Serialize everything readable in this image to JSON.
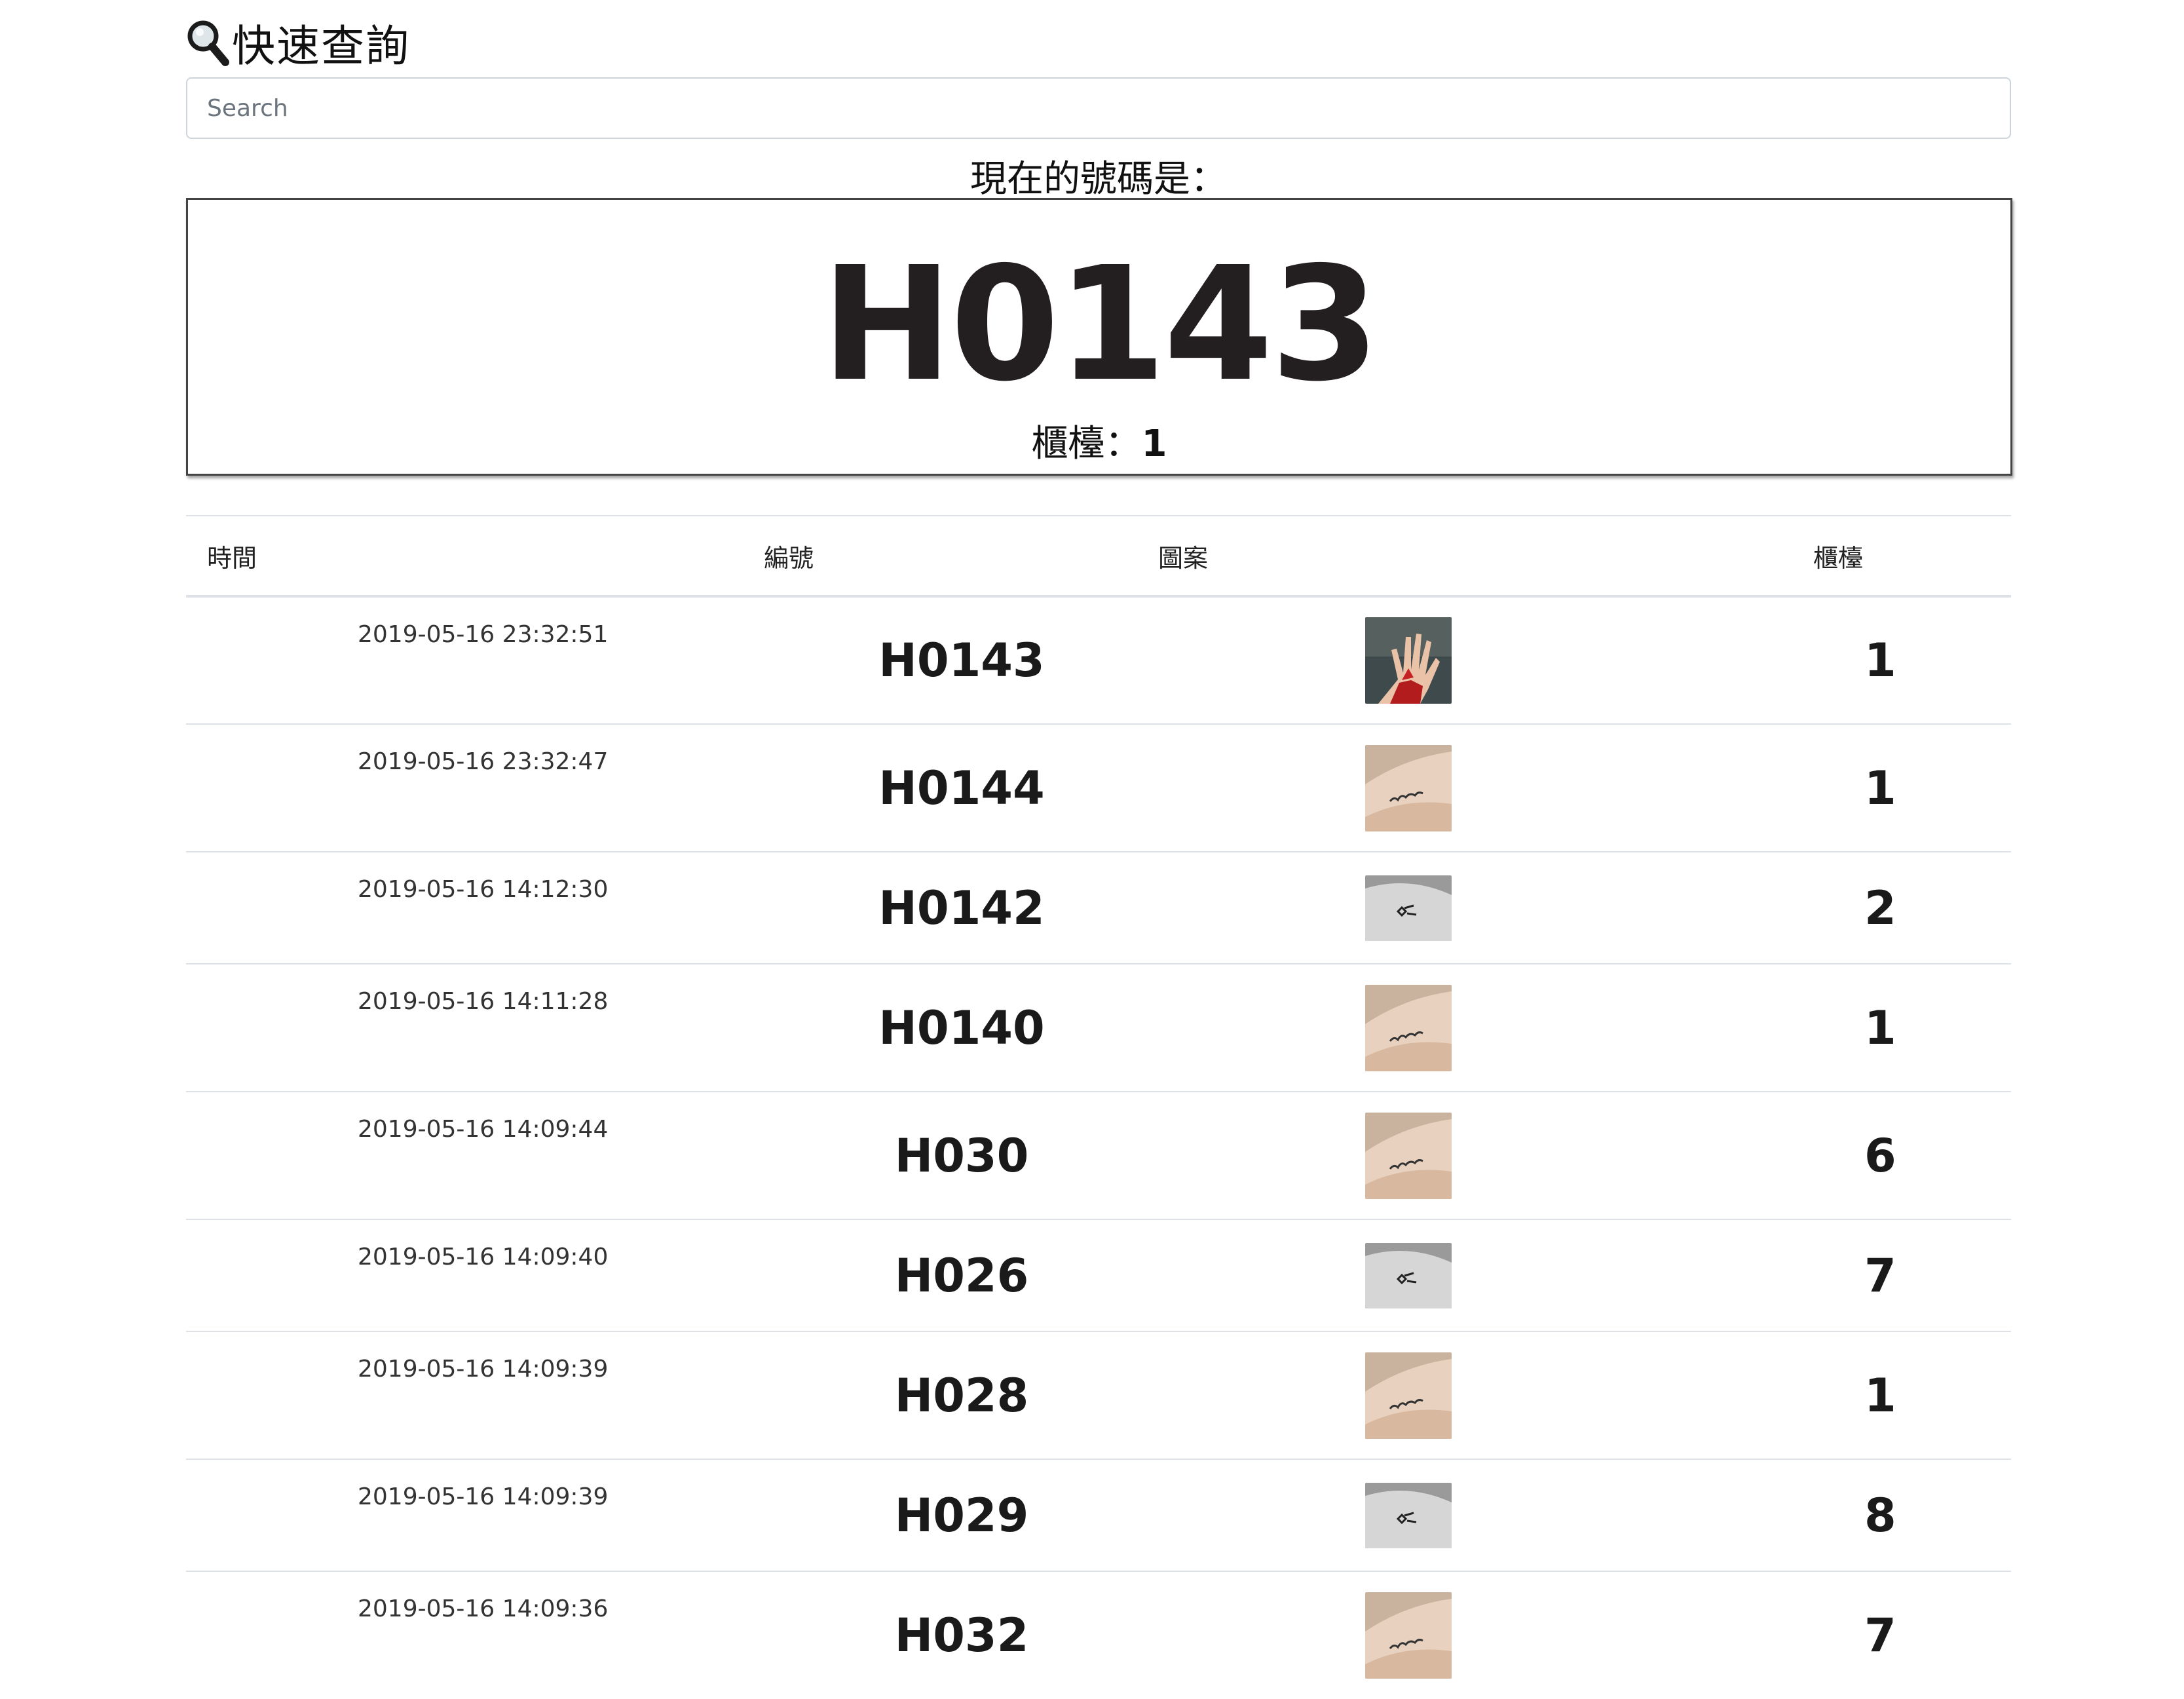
{
  "header": {
    "title": "快速查詢",
    "search_placeholder": "Search"
  },
  "current": {
    "label": "現在的號碼是：",
    "number": "H0143",
    "counter_label": "櫃檯：",
    "counter_value": "1"
  },
  "table": {
    "columns": [
      "時間",
      "編號",
      "圖案",
      "櫃檯"
    ],
    "rows": [
      {
        "time": "2019-05-16 23:32:51",
        "number": "H0143",
        "pattern": "red-hand-photo",
        "counter": "1"
      },
      {
        "time": "2019-05-16 23:32:47",
        "number": "H0144",
        "pattern": "wrist-script-tattoo",
        "counter": "1"
      },
      {
        "time": "2019-05-16 14:12:30",
        "number": "H0142",
        "pattern": "grey-symbol-tattoo",
        "counter": "2"
      },
      {
        "time": "2019-05-16 14:11:28",
        "number": "H0140",
        "pattern": "wrist-script-tattoo",
        "counter": "1"
      },
      {
        "time": "2019-05-16 14:09:44",
        "number": "H030",
        "pattern": "wrist-script-tattoo",
        "counter": "6"
      },
      {
        "time": "2019-05-16 14:09:40",
        "number": "H026",
        "pattern": "grey-symbol-tattoo",
        "counter": "7"
      },
      {
        "time": "2019-05-16 14:09:39",
        "number": "H028",
        "pattern": "wrist-script-tattoo",
        "counter": "1"
      },
      {
        "time": "2019-05-16 14:09:39",
        "number": "H029",
        "pattern": "grey-symbol-tattoo",
        "counter": "8"
      },
      {
        "time": "2019-05-16 14:09:36",
        "number": "H032",
        "pattern": "wrist-script-tattoo",
        "counter": "7"
      }
    ]
  }
}
